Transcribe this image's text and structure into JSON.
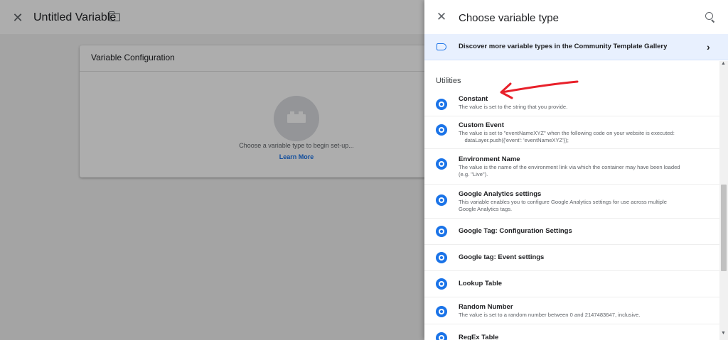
{
  "editor": {
    "title": "Untitled Variable",
    "close_icon": "close-icon",
    "folder_icon": "folder-icon",
    "card_title": "Variable Configuration",
    "hint": "Choose a variable type to begin set-up...",
    "learn_more": "Learn More",
    "placeholder_icon": "brick-icon"
  },
  "drawer": {
    "title": "Choose variable type",
    "close_glyph": "✕",
    "search_icon": "search-icon",
    "banner": {
      "icon": "tag-icon",
      "text": "Discover more variable types in the Community Template Gallery",
      "chevron": "›"
    },
    "section_title": "Utilities",
    "items": [
      {
        "name": "Constant",
        "desc": "The value is set to the string that you provide."
      },
      {
        "name": "Custom Event",
        "desc": "The value is set to \"eventNameXYZ\" when the following code on your website is executed:\n    dataLayer.push({'event': 'eventNameXYZ'});"
      },
      {
        "name": "Environment Name",
        "desc": "The value is the name of the environment link via which the container may have been loaded\n(e.g. \"Live\")."
      },
      {
        "name": "Google Analytics settings",
        "desc": "This variable enables you to configure Google Analytics settings for use across multiple\nGoogle Analytics tags."
      },
      {
        "name": "Google Tag: Configuration Settings",
        "desc": ""
      },
      {
        "name": "Google tag: Event settings",
        "desc": ""
      },
      {
        "name": "Lookup Table",
        "desc": ""
      },
      {
        "name": "Random Number",
        "desc": "The value is set to a random number between 0 and 2147483647, inclusive."
      },
      {
        "name": "RegEx Table",
        "desc": ""
      }
    ]
  },
  "colors": {
    "accent": "#1a73e8",
    "annotation_arrow": "#e8202a",
    "banner_bg": "#e8f0fe"
  }
}
